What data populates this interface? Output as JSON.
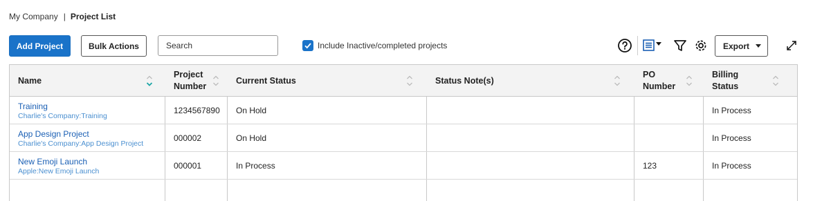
{
  "breadcrumb": {
    "parent": "My Company",
    "separator": "|",
    "current": "Project List"
  },
  "toolbar": {
    "add_project": "Add Project",
    "bulk_actions": "Bulk Actions",
    "search_placeholder": "Search",
    "include_inactive_label": "Include Inactive/completed projects",
    "include_inactive_checked": true,
    "export_label": "Export",
    "accent_color": "#1a73c9"
  },
  "table": {
    "columns": [
      {
        "line1": "Name",
        "line2": ""
      },
      {
        "line1": "Project",
        "line2": "Number"
      },
      {
        "line1": "Current Status",
        "line2": ""
      },
      {
        "line1": "Status Note(s)",
        "line2": ""
      },
      {
        "line1": "PO",
        "line2": "Number"
      },
      {
        "line1": "Billing",
        "line2": "Status"
      }
    ],
    "sorted_column": "Name",
    "rows": [
      {
        "name": "Training",
        "sub": "Charlie's Company:Training",
        "number": "1234567890",
        "status": "On Hold",
        "note": "",
        "po": "",
        "billing": "In Process"
      },
      {
        "name": "App Design Project",
        "sub": "Charlie's Company:App Design Project",
        "number": "000002",
        "status": "On Hold",
        "note": "",
        "po": "",
        "billing": "In Process"
      },
      {
        "name": "New Emoji Launch",
        "sub": "Apple:New Emoji Launch",
        "number": "000001",
        "status": "In Process",
        "note": "",
        "po": "123",
        "billing": "In Process"
      }
    ]
  }
}
